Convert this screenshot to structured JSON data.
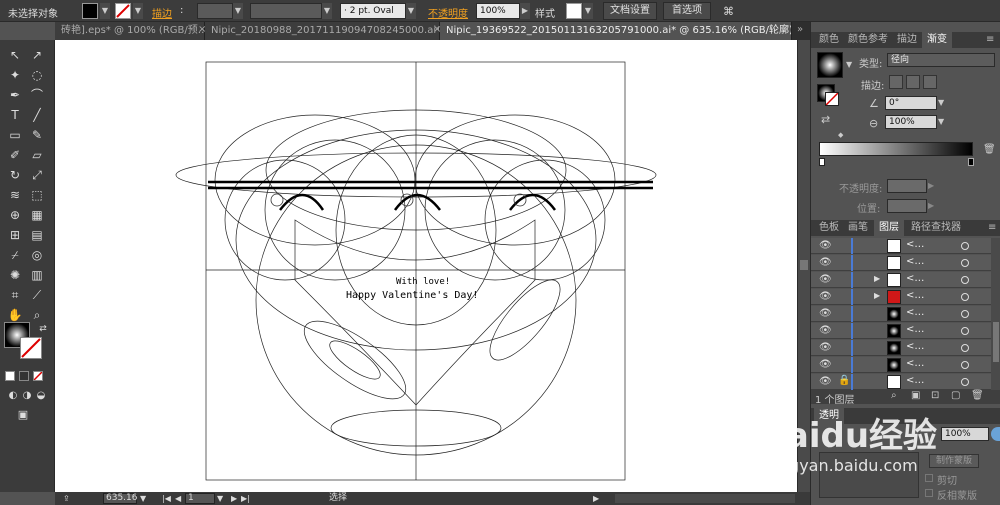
{
  "control_bar": {
    "selection_label": "未选择对象",
    "stroke_label": "描边",
    "brush_label": "2 pt. Oval",
    "opacity_label": "不透明度",
    "opacity_value": "100%",
    "style_label": "样式",
    "doc_setup_button": "文档设置",
    "preferences_button": "首选项"
  },
  "tabs": [
    {
      "label": "砖艳].eps* @ 100% (RGB/预…"
    },
    {
      "label": "Nipic_20180988_20171119094708245000.ai*"
    },
    {
      "label": "Nipic_19369522_20150113163205791000.ai* @ 635.16% (RGB/轮廓)"
    }
  ],
  "canvas": {
    "text_line1": "With love!",
    "text_line2": "Happy Valentine's Day!"
  },
  "status": {
    "zoom": "635.16",
    "page": "1",
    "tool_name": "选择"
  },
  "gradient_panel": {
    "tabs": [
      "颜色",
      "颜色参考",
      "描边",
      "渐变"
    ],
    "type_label": "类型:",
    "type_value": "径向",
    "stroke_label": "描边:",
    "angle_value": "0°",
    "aspect_value": "100%",
    "opacity_label": "不透明度:",
    "position_label": "位置:"
  },
  "layers_panel": {
    "tabs": [
      "色板",
      "画笔",
      "图层",
      "路径查找器"
    ],
    "rows": [
      {
        "name": "<…",
        "thumb": "white",
        "expand": false,
        "lock": false
      },
      {
        "name": "<…",
        "thumb": "white",
        "expand": false,
        "lock": false
      },
      {
        "name": "<…",
        "thumb": "white",
        "expand": true,
        "lock": false
      },
      {
        "name": "<…",
        "thumb": "heart",
        "expand": true,
        "lock": false
      },
      {
        "name": "<…",
        "thumb": "black",
        "expand": false,
        "lock": false
      },
      {
        "name": "<…",
        "thumb": "black",
        "expand": false,
        "lock": false
      },
      {
        "name": "<…",
        "thumb": "black",
        "expand": false,
        "lock": false
      },
      {
        "name": "<…",
        "thumb": "black",
        "expand": false,
        "lock": false
      },
      {
        "name": "<…",
        "thumb": "white",
        "expand": false,
        "lock": true
      }
    ],
    "count_label": "1 个图层"
  },
  "transparency_panel": {
    "title": "透明",
    "opacity_value": "100%",
    "mask_button": "制作蒙版",
    "clip_label": "剪切",
    "invert_label": "反相蒙版"
  },
  "watermark": {
    "brand": "Baidu经验",
    "url": "jingyan.baidu.com"
  },
  "colors": {
    "accent": "#4a7bd6",
    "heart": "#d01818",
    "orange_label": "#f0a020"
  }
}
